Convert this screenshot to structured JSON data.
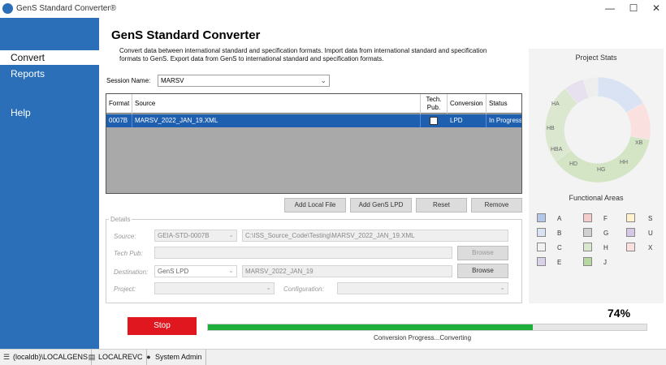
{
  "window": {
    "title": "GenS Standard Converter®",
    "minimize": "—",
    "maximize": "☐",
    "close": "✕"
  },
  "sidebar": {
    "items": [
      {
        "label": "Convert",
        "active": true
      },
      {
        "label": "Reports",
        "active": false
      },
      {
        "label": "Help",
        "active": false
      }
    ]
  },
  "main": {
    "title": "GenS Standard Converter",
    "intro": "Convert data between international standard and specification formats. Import data from international standard and specification formats to GenS. Export data from GenS to international standard and specification formats.",
    "session_label": "Session Name:",
    "session_value": "MARSV"
  },
  "grid": {
    "columns": [
      "Format",
      "Source",
      "Tech. Pub.",
      "Conversion",
      "Status"
    ],
    "rows": [
      {
        "format": "0007B",
        "source": "MARSV_2022_JAN_19.XML",
        "tech_pub": false,
        "conversion": "LPD",
        "status": "In Progress"
      }
    ]
  },
  "buttons": {
    "add_local_file": "Add Local File",
    "add_gens_lpd": "Add GenS LPD",
    "reset": "Reset",
    "remove": "Remove"
  },
  "details": {
    "legend": "Details",
    "source_label": "Source:",
    "source_spec": "GEIA-STD-0007B",
    "source_path": "C:\\ISS_Source_Code\\Testing\\MARSV_2022_JAN_19.XML",
    "tech_pub_label": "Tech Pub:",
    "tech_pub_value": "",
    "browse_label": "Browse",
    "destination_label": "Destination:",
    "destination_value": "GenS LPD",
    "destination_name": "MARSV_2022_JAN_19",
    "project_label": "Project:",
    "project_value": "",
    "configuration_label": "Configuration:",
    "configuration_value": ""
  },
  "stats": {
    "title": "Project Stats",
    "functional_areas_title": "Functional Areas",
    "donut_labels": [
      "HA",
      "HB",
      "HBA",
      "HD",
      "HG",
      "HH",
      "XB"
    ],
    "legend": [
      {
        "label": "A",
        "color": "#b4c7e7"
      },
      {
        "label": "B",
        "color": "#dae3f3"
      },
      {
        "label": "C",
        "color": "#f2f2f2"
      },
      {
        "label": "E",
        "color": "#d9d2e9"
      },
      {
        "label": "F",
        "color": "#f4cccc"
      },
      {
        "label": "G",
        "color": "#d0d0d0"
      },
      {
        "label": "H",
        "color": "#d9e7cc"
      },
      {
        "label": "J",
        "color": "#b7d7a0"
      },
      {
        "label": "S",
        "color": "#fff2cc"
      },
      {
        "label": "U",
        "color": "#d5c8e6"
      },
      {
        "label": "X",
        "color": "#fbe0e0"
      }
    ]
  },
  "progress": {
    "stop_label": "Stop",
    "percent_value": 0.74,
    "percent_text": "74%",
    "status_text": "Conversion Progress...Converting"
  },
  "statusbar": {
    "server": "(localdb)\\LOCALGENS",
    "database": "LOCALREVC",
    "user": "System Admin",
    "server_icon": "menu-icon",
    "database_icon": "database-icon",
    "user_icon": "user-icon"
  },
  "colors": {
    "brand": "#2a6fb8",
    "selection": "#1e5fb0",
    "stop": "#e0171f",
    "progress": "#1eae3c"
  }
}
